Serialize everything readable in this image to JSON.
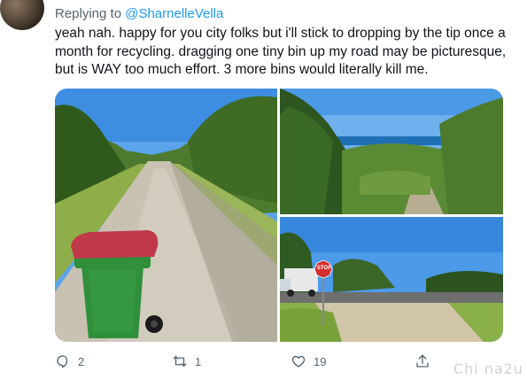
{
  "tweet": {
    "reply_prefix": "Replying to",
    "reply_handle": "@SharnelleVella",
    "text": "yeah nah. happy for you city folks but i'll stick to dropping by the tip once a\nmonth for recycling. dragging one tiny bin up my road may be picturesque,\nbut is WAY too much effort. 3 more bins would literally kill me."
  },
  "media": {
    "photos": [
      {
        "subject": "gravel-road-with-red-lid-wheelie-bin"
      },
      {
        "subject": "coastal-scrub-with-ocean-view"
      },
      {
        "subject": "road-junction-with-stop-sign-and-truck"
      }
    ],
    "stop_sign_text": "STOP",
    "colors": {
      "sky": "#3d8ee0",
      "bin_body": "#2f8f3a",
      "bin_lid": "#c0394a",
      "stop": "#d32f2f"
    }
  },
  "actions": {
    "reply_count": "2",
    "retweet_count": "1",
    "like_count": "19",
    "share_label": ""
  },
  "watermark": "Chi  na2u",
  "icons": [
    "reply-icon",
    "retweet-icon",
    "like-icon",
    "share-icon"
  ],
  "colors": {
    "link": "#1d9bf0",
    "secondary_text": "#536471",
    "text": "#0f1419"
  }
}
